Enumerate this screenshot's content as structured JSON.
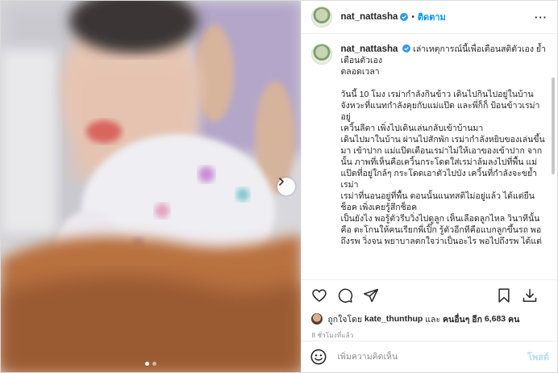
{
  "post": {
    "username": "nat_nattasha",
    "follow_label": "ติดตาม",
    "separator": "•",
    "more_label": "···",
    "caption": {
      "first_line": "เล่าเหตุการณ์นี้เพื่อเตือนสติตัวเอง ย้ำเตือนตัวเอง\nตลอดเวลา",
      "body": "วันนี้ 10 โมง เรม่ากำลังกินข้าว เดินไปกินไปอยู่ในบ้าน\nจังหวะที่แนทกำลังคุยกับแม่แป๊ด และพี่ก็ก็ ป้อนข้าวเรม่าอยู่\nเควิ้นลีดา เพิ่งไปเดินเล่นกลับเข้าบ้านมา\nเดินไปมาในบ้าน ผ่านไปสักพัก เรม่ากำลังหยิบของเล่นขึ้นมา เข้าปาก แม่แป๊ดเตือนเรม่าไม่ให้เอาของเข้าปาก จากนั้น ภาพที่เห็นคือเควิ้นกระโดดใส่เรม่าล้มลงไปที่พื้น แม่แป๊ดที่อยู่ใกล้ๆ กระโดดเอาตัวไปบัง เควิ้นที่กำลังจะขย้ำเรม่า\nเรม่าที่นอนอยู่ที่พื้น ตอนนั้นแนทสติไม่อยู่แล้ว ได้แต่ยืนช็อค เพิ่งเคยรู้สึกช็อค\nเป็นยังไง พอรู้ตัวรีบวิ่งไปดูลูก เห็นเลือดลูกไหล วินาทีนั้นคือ ตะโกนให้คนเรียกพี่เปิ๊ก รู้ตัวอีกทีคือแบกลูกขึ้นรถ พอถึงรพ วิ่งจน พยาบาลตกใจว่าเป็นอะไร พอไปถึงรพ ได้แต่"
    },
    "likes": {
      "prefix": "ถูกใจโดย",
      "user": "kate_thunthup",
      "middle": "และ",
      "others_label": "คนอื่นๆ อีก",
      "count": "6,683",
      "suffix": "คน"
    },
    "timestamp": "8 ชั่วโมงที่แล้ว",
    "comment_placeholder": "เพิ่มความคิดเห็น",
    "post_button": "โพสต์",
    "carousel": {
      "total": 2,
      "active": 1
    }
  },
  "icons": {
    "like": "heart-icon",
    "comment": "comment-icon",
    "share": "send-icon",
    "save": "bookmark-icon",
    "download": "download-icon",
    "emoji": "emoji-icon",
    "verified": "verified-badge-icon",
    "next": "chevron-right-icon"
  },
  "colors": {
    "accent": "#0095f6",
    "verified": "#3897f0",
    "post_button_disabled": "#b2dffc"
  }
}
